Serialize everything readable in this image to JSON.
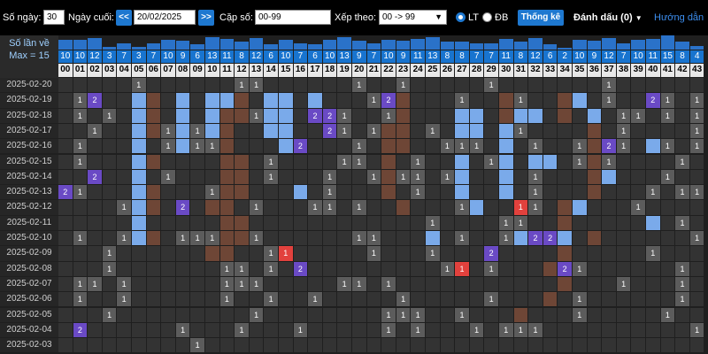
{
  "toolbar": {
    "days_label": "Số ngày:",
    "days_value": "30",
    "last_day_label": "Ngày cuối:",
    "prev_label": "<<",
    "date_value": "20/02/2025",
    "next_label": ">>",
    "pairs_label": "Cặp số:",
    "pairs_value": "00-99",
    "sort_label": "Xếp theo:",
    "sort_value": "00 -> 99",
    "radio_lt": "LT",
    "radio_db": "ĐB",
    "stats_button": "Thống kê",
    "mark_label": "Đánh dấu (0)",
    "guide_link": "Hướng dẫn"
  },
  "header": {
    "times_label": "Số lần về",
    "max_label": "Max = 15"
  },
  "colors": {
    "none": "#333333",
    "streak_light": "#7aaaea",
    "streak_brown": "#6e4636",
    "hit_one": "#5c5c5c",
    "hit_two": "#6a4ac5",
    "hit_special": "#e2413d",
    "accent": "#1e78d0"
  },
  "grid": {
    "numbers": [
      "00",
      "01",
      "02",
      "03",
      "04",
      "05",
      "06",
      "07",
      "08",
      "09",
      "10",
      "11",
      "12",
      "13",
      "14",
      "15",
      "16",
      "17",
      "18",
      "19",
      "20",
      "21",
      "22",
      "23",
      "24",
      "25",
      "26",
      "27",
      "28",
      "29",
      "30",
      "31",
      "32",
      "33",
      "34",
      "35",
      "36",
      "37",
      "38",
      "39",
      "40",
      "41",
      "42",
      "43"
    ],
    "counts": [
      10,
      10,
      12,
      3,
      7,
      3,
      7,
      10,
      9,
      6,
      13,
      11,
      8,
      12,
      6,
      10,
      7,
      6,
      10,
      13,
      9,
      7,
      10,
      9,
      11,
      13,
      8,
      8,
      7,
      7,
      11,
      8,
      12,
      6,
      2,
      10,
      9,
      12,
      7,
      10,
      11,
      15,
      8,
      4
    ],
    "dates": [
      "2025-02-20",
      "2025-02-19",
      "2025-02-18",
      "2025-02-17",
      "2025-02-16",
      "2025-02-15",
      "2025-02-14",
      "2025-02-13",
      "2025-02-12",
      "2025-02-11",
      "2025-02-10",
      "2025-02-09",
      "2025-02-08",
      "2025-02-07",
      "2025-02-06",
      "2025-02-05",
      "2025-02-04",
      "2025-02-03"
    ],
    "rows": [
      "00000100000011000000100100000100000001000000",
      "01200LB0L0LLB0LL0L00012B000100B100BL01002101",
      "01010LB0L0LBB1LL0221001B000LL0BLL0B0L0110101",
      "00100LB1L1LB00LL002101BB010LL0L10000B0100001",
      "01000L01L11B000L200010BB001110L01001B210L101",
      "01000LB0000BB010000110B0100L01L0LL01B1000010",
      "00200L01000BB010001001B1101L00L01000BL000100",
      "21000LB0001BB000L01000B0100L00L01000B0001011",
      "00001LB020BB01000110100B0001L00R10BL0001000",
      "00000L00000BB000000000000100001100B00000L01",
      "01001LB0111BB100000011000L01001L22L0B0000001",
      "0001000000BB001R000001000100020000B00000100",
      "000100000001101020000000001R01000B21000000100",
      "0110100000011100000110100000000000B0001000100",
      "010010000001001001000001000001000B0100000010",
      "0001000000000100000000111001000B000100000100",
      "0200000010001000100000101000101110000000000100",
      "0000000001000000000000000000000000000000000000"
    ]
  }
}
